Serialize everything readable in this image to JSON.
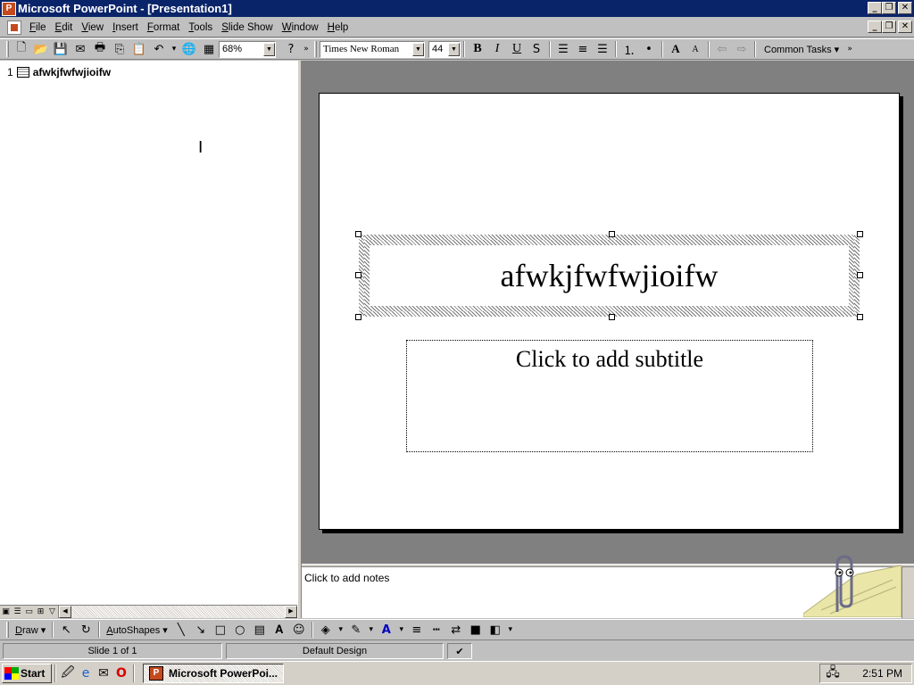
{
  "window": {
    "title": "Microsoft PowerPoint - [Presentation1]",
    "app_icon": "powerpoint-icon",
    "controls": [
      "_",
      "❐",
      "✕"
    ]
  },
  "menu": {
    "items": [
      "File",
      "Edit",
      "View",
      "Insert",
      "Format",
      "Tools",
      "Slide Show",
      "Window",
      "Help"
    ]
  },
  "toolbar": {
    "zoom": "68%",
    "font_name": "Times New Roman",
    "font_size": "44",
    "common_tasks": "Common Tasks ▾",
    "bold": "B",
    "italic": "I",
    "underline": "U",
    "shadow": "S"
  },
  "outline": {
    "slide_number": "1",
    "slide_title": "afwkjfwfwjioifw"
  },
  "slide": {
    "title": "afwkjfwfwjioifw",
    "subtitle_placeholder": "Click to add subtitle"
  },
  "notes": {
    "placeholder": "Click to add notes"
  },
  "drawing_toolbar": {
    "draw": "Draw ▾",
    "autoshapes": "AutoShapes ▾"
  },
  "status": {
    "slide_info": "Slide 1 of 1",
    "design": "Default Design"
  },
  "taskbar": {
    "start": "Start",
    "task": "Microsoft PowerPoi...",
    "time": "2:51 PM"
  },
  "colors": {
    "titlebar": "#0a246a",
    "chrome": "#d4d0c8",
    "workspace": "#808080"
  }
}
